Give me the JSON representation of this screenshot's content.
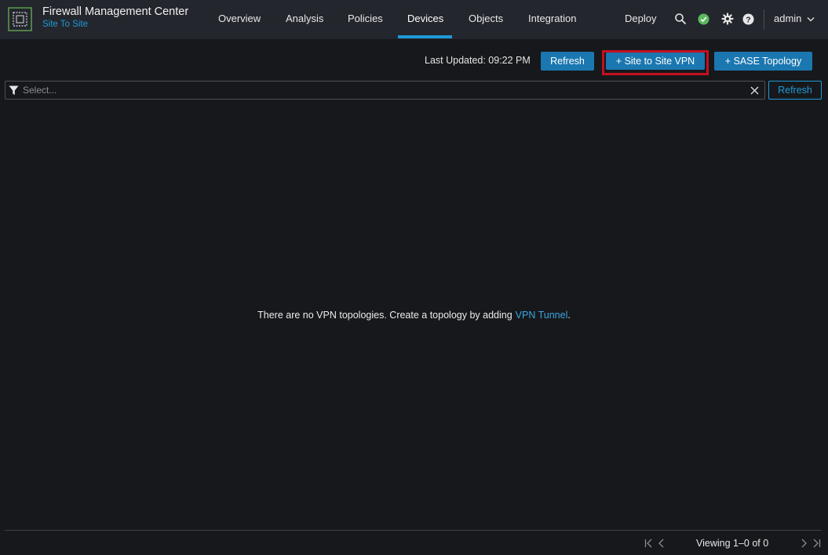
{
  "header": {
    "app_title": "Firewall Management Center",
    "app_subtitle": "Site To Site",
    "nav": [
      {
        "label": "Overview"
      },
      {
        "label": "Analysis"
      },
      {
        "label": "Policies"
      },
      {
        "label": "Devices",
        "active": true
      },
      {
        "label": "Objects"
      },
      {
        "label": "Integration"
      }
    ],
    "deploy_label": "Deploy",
    "user_label": "admin",
    "icons": [
      "search-icon",
      "status-ok-icon",
      "gear-icon",
      "help-icon",
      "chevron-down-icon"
    ],
    "status_color": "#5cb85c"
  },
  "toolbar": {
    "last_updated": "Last Updated: 09:22 PM",
    "refresh_label": "Refresh",
    "site_to_site_label": "+ Site to Site VPN",
    "sase_label": "+ SASE Topology"
  },
  "filter": {
    "placeholder": "Select...",
    "refresh_label": "Refresh"
  },
  "empty_state": {
    "message": "There are no VPN topologies. Create a topology by adding",
    "link": "VPN Tunnel",
    "suffix": "."
  },
  "pagination": {
    "viewing": "Viewing 1–0 of 0"
  },
  "colors": {
    "accent": "#1e9ad6",
    "button": "#1b77b0",
    "highlight": "#c50f1e",
    "background": "#17181c",
    "topbar": "#23262d"
  }
}
